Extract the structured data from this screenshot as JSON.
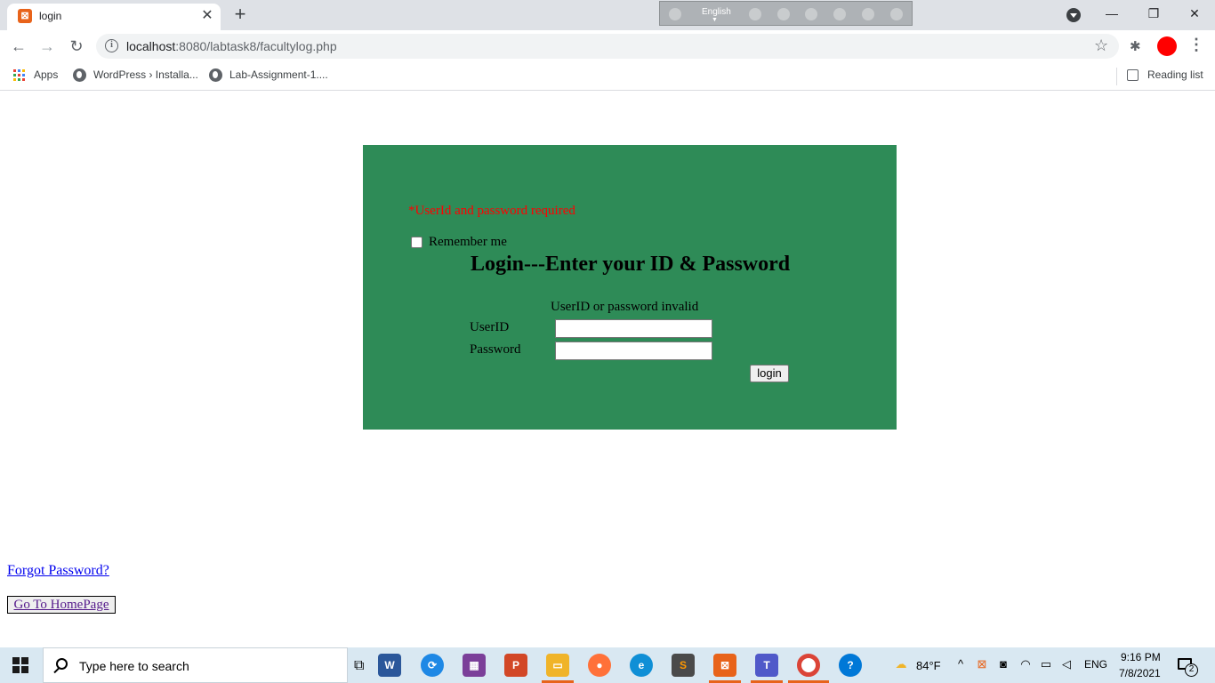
{
  "browser": {
    "tab": {
      "title": "login",
      "close_glyph": "✕",
      "favicon": "xampp-icon"
    },
    "new_tab_glyph": "+",
    "language_bar": {
      "language": "English"
    },
    "window_controls": {
      "minimize": "—",
      "restore": "❐",
      "close": "✕"
    },
    "toolbar": {
      "back_glyph": "←",
      "forward_glyph": "→",
      "reload_glyph": "↻",
      "url_host": "localhost",
      "url_path": ":8080/labtask8/facultylog.php",
      "star_glyph": "☆",
      "extensions_glyph": "✱",
      "menu_glyph": "⋮"
    },
    "bookmarks": {
      "apps_label": "Apps",
      "items": [
        {
          "label": "WordPress › Installa..."
        },
        {
          "label": "Lab-Assignment-1...."
        }
      ],
      "reading_list_label": "Reading list"
    }
  },
  "page": {
    "error_required": "*UserId and password required",
    "remember_label": "Remember me",
    "heading": "Login---Enter your ID & Password",
    "error_invalid": "UserID or password invalid",
    "userid_label": "UserID",
    "userid_value": "",
    "password_label": "Password",
    "password_value": "",
    "login_button": "login",
    "forgot_link": "Forgot Password?",
    "home_button": "Go To HomePage",
    "panel_color": "#2e8b57",
    "error_color": "#ff0000"
  },
  "taskbar": {
    "search_placeholder": "Type here to search",
    "apps": [
      "word-icon",
      "sync-icon",
      "winrar-icon",
      "powerpoint-icon",
      "file-explorer-icon",
      "firefox-icon",
      "edge-icon",
      "sublime-icon",
      "xampp-icon",
      "teams-icon",
      "chrome-icon",
      "help-icon"
    ],
    "weather": "84°F",
    "language": "ENG",
    "time": "9:16 PM",
    "date": "7/8/2021",
    "notification_count": "2"
  }
}
